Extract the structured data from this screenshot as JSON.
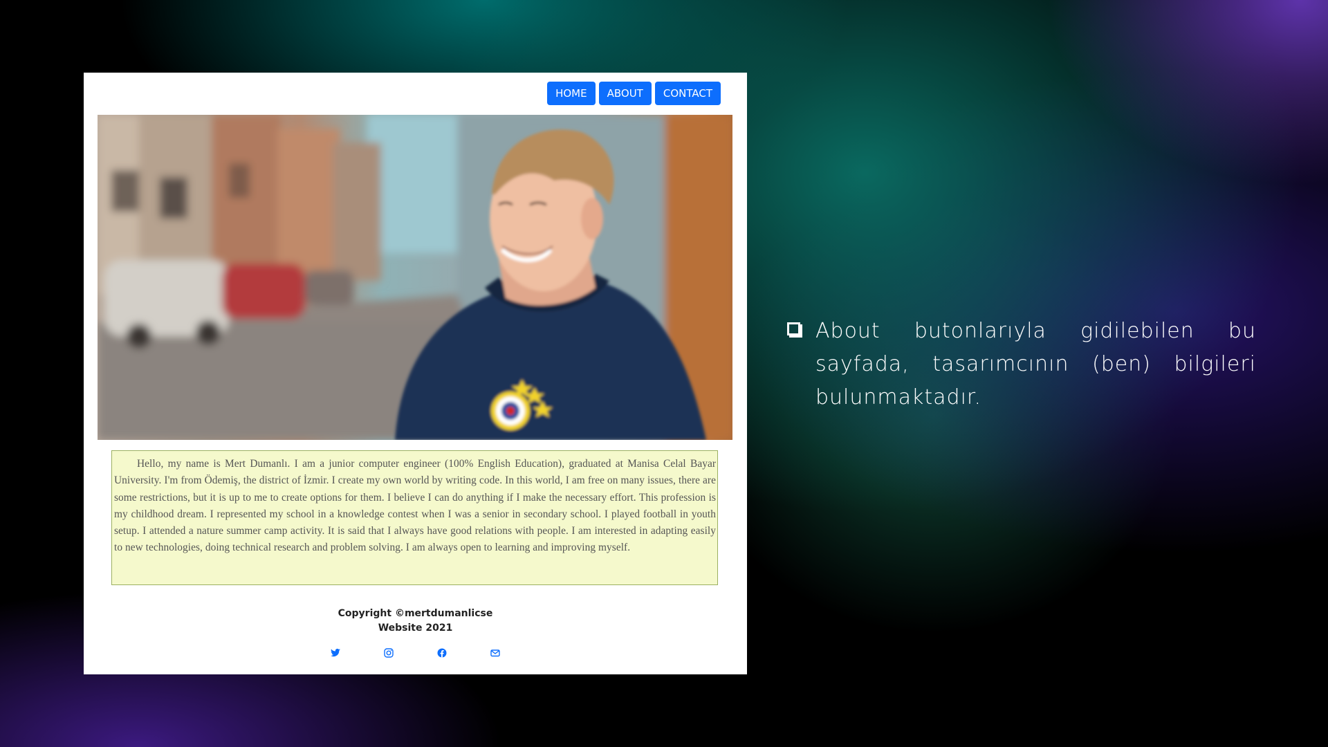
{
  "nav": {
    "items": [
      "HOME",
      "ABOUT",
      "CONTACT"
    ]
  },
  "hero": {
    "alt": "Portrait photo of a smiling young man in a navy sweatshirt on a city street"
  },
  "bio": {
    "text": "Hello, my name is Mert Dumanlı. I am a junior computer engineer (100% English Education), graduated at Manisa Celal Bayar University. I'm from Ödemiş, the district of İzmir. I create my own world by writing code. In this world, I am free on many issues, there are some restrictions, but it is up to me to create options for them. I believe I can do anything if I make the necessary effort. This profession is my childhood dream. I represented my school in a knowledge contest when I was a senior in secondary school. I played football in youth setup. I attended a nature summer camp activity. It is said that I always have good relations with people. I am interested in adapting easily to new technologies, doing technical research and problem solving. I am always open to learning and improving myself."
  },
  "footer": {
    "copyright_line1": "Copyright ©mertdumanlicse",
    "copyright_line2": "Website 2021",
    "social_icons": [
      "twitter-icon",
      "instagram-icon",
      "facebook-icon",
      "envelope-icon"
    ]
  },
  "slide": {
    "bullet_text": "About butonlarıyla gidilebilen bu sayfada, tasarımcının (ben) bilgileri bulunmaktadır."
  },
  "colors": {
    "nav_button": "#0d6efd",
    "bio_background": "#f5f9cc",
    "bio_border": "#9bb060",
    "social_icon": "#0d6efd"
  }
}
